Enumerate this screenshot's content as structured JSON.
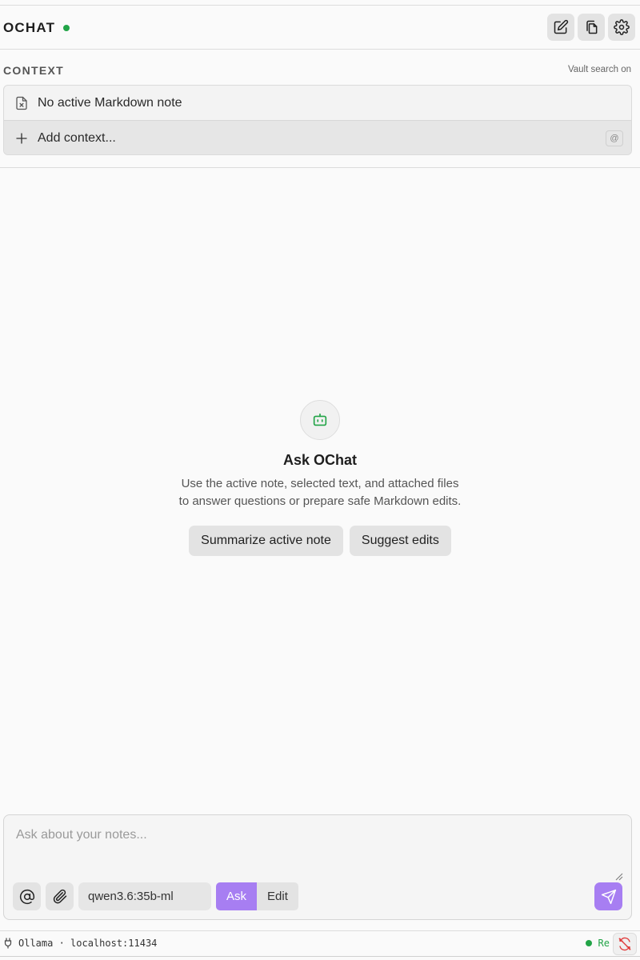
{
  "header": {
    "title": "OCHAT",
    "status_color": "#22a447",
    "actions": [
      {
        "icon": "new-chat-icon"
      },
      {
        "icon": "copy-icon"
      },
      {
        "icon": "gear-icon"
      }
    ]
  },
  "context": {
    "label": "CONTEXT",
    "vault_status": "Vault search on",
    "active_note": "No active Markdown note",
    "add_label": "Add context...",
    "mention_hint": "@"
  },
  "empty_state": {
    "icon": "bot-icon",
    "title": "Ask OChat",
    "description": "Use the active note, selected text, and attached files to answer questions or prepare safe Markdown edits.",
    "suggestions": [
      "Summarize active note",
      "Suggest edits"
    ]
  },
  "composer": {
    "placeholder": "Ask about your notes...",
    "model": "qwen3.6:35b-ml",
    "modes": [
      "Ask",
      "Edit"
    ],
    "active_mode": "Ask",
    "accent": "#a77ef2"
  },
  "statusbar": {
    "connection": "Ollama · localhost:11434",
    "state": "Re"
  }
}
